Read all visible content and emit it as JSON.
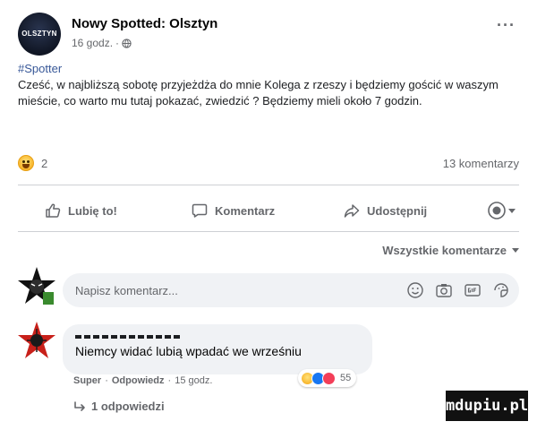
{
  "post": {
    "page_name": "Nowy Spotted: Olsztyn",
    "avatar_text": "OLSZTYN",
    "time": "16 godz.",
    "dot": "·",
    "more_label": "···",
    "hashtag": "#Spotter",
    "text": "Cześć, w najbliższą sobotę przyjeżdża do mnie Kolega z rzeszy i będziemy gościć w waszym mieście, co warto mu tutaj pokazać, zwiedzić ? Będziemy mieli około 7 godzin.",
    "reaction_count": "2",
    "comment_count": "13 komentarzy"
  },
  "actions": {
    "like": "Lubię to!",
    "comment": "Komentarz",
    "share": "Udostępnij"
  },
  "comments": {
    "sort_label": "Wszystkie komentarze",
    "input_placeholder": "Napisz komentarz...",
    "items": [
      {
        "text": "Niemcy widać lubią wpadać we wrześniu",
        "reaction_count": "55",
        "like_label": "Super",
        "reply_label": "Odpowiedz",
        "time": "15 godz.",
        "replies_label": "1 odpowiedzi"
      }
    ]
  },
  "watermark": "mdupiu.pl",
  "colors": {
    "link": "#385898",
    "secondary_text": "#65676b",
    "bubble": "#f0f2f5",
    "like_blue": "#1877f2",
    "love_red": "#f33e58",
    "haha_yellow": "#f7b125"
  },
  "icons": [
    "globe-icon",
    "more-options-icon",
    "thumbs-up-icon",
    "comment-icon",
    "share-icon",
    "audience-icon",
    "emoji-icon",
    "camera-icon",
    "gif-icon",
    "sticker-icon",
    "reply-arrow-icon"
  ]
}
